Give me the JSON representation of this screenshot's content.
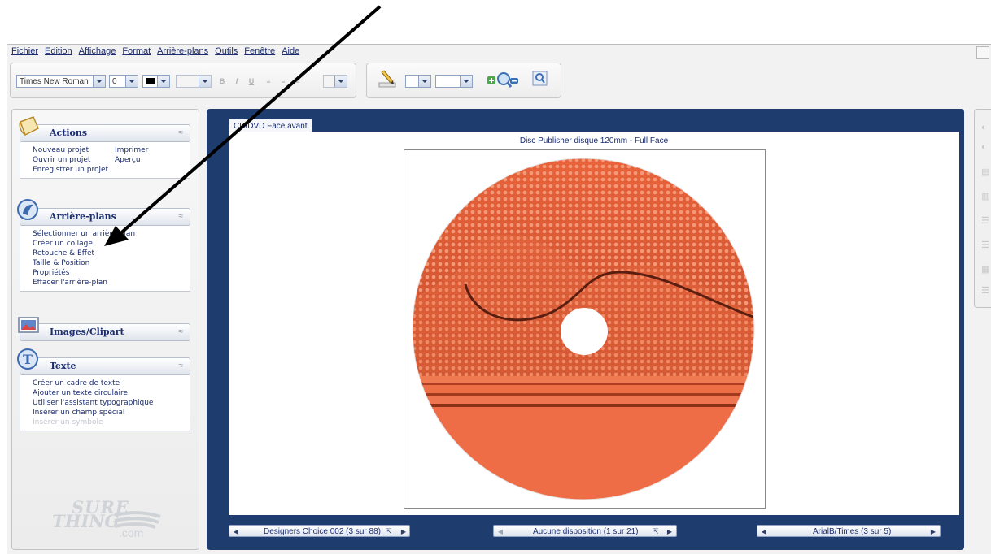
{
  "menu": [
    "Fichier",
    "Edition",
    "Affichage",
    "Format",
    "Arrière-plans",
    "Outils",
    "Fenêtre",
    "Aide"
  ],
  "toolbar": {
    "font_name": "Times New Roman",
    "font_size": "0",
    "bold_icon": "B",
    "italic_icon": "I",
    "underline_icon": "U",
    "icons": [
      "pencil-icon",
      "zoom-in-icon",
      "zoom-out-icon",
      "zoom-fit-icon"
    ]
  },
  "panels": {
    "actions": {
      "title": "Actions",
      "col1": [
        "Nouveau projet",
        "Ouvrir un projet",
        "Enregistrer un projet"
      ],
      "col2": [
        "Imprimer",
        "Aperçu"
      ]
    },
    "arriere_plans": {
      "title": "Arrière-plans",
      "items": [
        "Sélectionner un arrière-plan",
        "Créer un collage",
        "Retouche & Effet",
        "Taille & Position",
        "Propriétés",
        "Effacer l'arrière-plan"
      ]
    },
    "images": {
      "title": "Images/Clipart"
    },
    "texte": {
      "title": "Texte",
      "items": [
        "Créer un cadre de texte",
        "Ajouter un texte circulaire",
        "Utiliser l'assistant typographique",
        "Insérer un champ spécial"
      ],
      "disabled_item": "Insérer un symbole"
    }
  },
  "logo": {
    "line1": "SURE",
    "line2": "THING",
    "line3": ".com"
  },
  "document": {
    "tab_label": "CD/DVD Face avant",
    "caption": "Disc Publisher disque 120mm - Full Face",
    "disc_colors": {
      "primary": "#ee6e46",
      "dots": "#f08a66",
      "band": "#c64a2a"
    }
  },
  "navigators": {
    "design": "Designers Choice 002 (3 sur 88)",
    "layout": "Aucune disposition (1 sur 21)",
    "fonts": "ArialB/Times (3 sur 5)"
  },
  "colors": {
    "frame_blue": "#1e3c6e",
    "link_blue": "#1b2d6e"
  }
}
